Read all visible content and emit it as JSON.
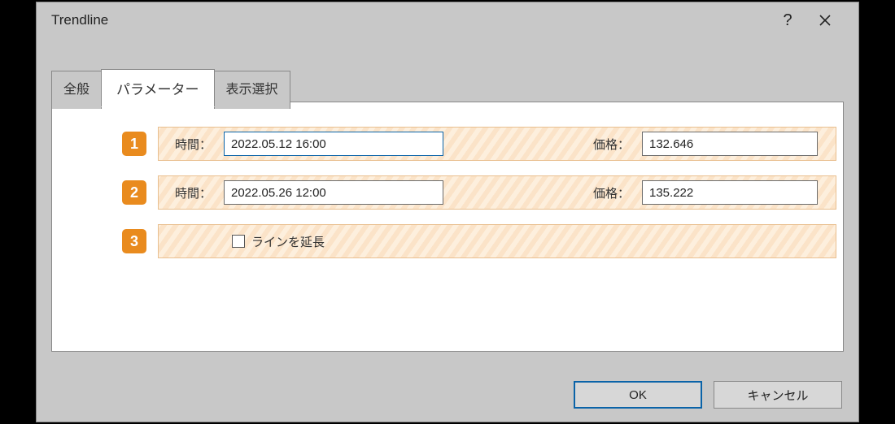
{
  "window": {
    "title": "Trendline"
  },
  "tabs": {
    "general": "全般",
    "parameters": "パラメーター",
    "display": "表示選択"
  },
  "markers": {
    "m1": "1",
    "m2": "2",
    "m3": "3"
  },
  "row1": {
    "time_label": "時間：",
    "time_value": "2022.05.12 16:00",
    "price_label": "価格：",
    "price_value": "132.646"
  },
  "row2": {
    "time_label": "時間：",
    "time_value": "2022.05.26 12:00",
    "price_label": "価格：",
    "price_value": "135.222"
  },
  "row3": {
    "extend_label": "ラインを延長"
  },
  "buttons": {
    "ok": "OK",
    "cancel": "キャンセル"
  }
}
